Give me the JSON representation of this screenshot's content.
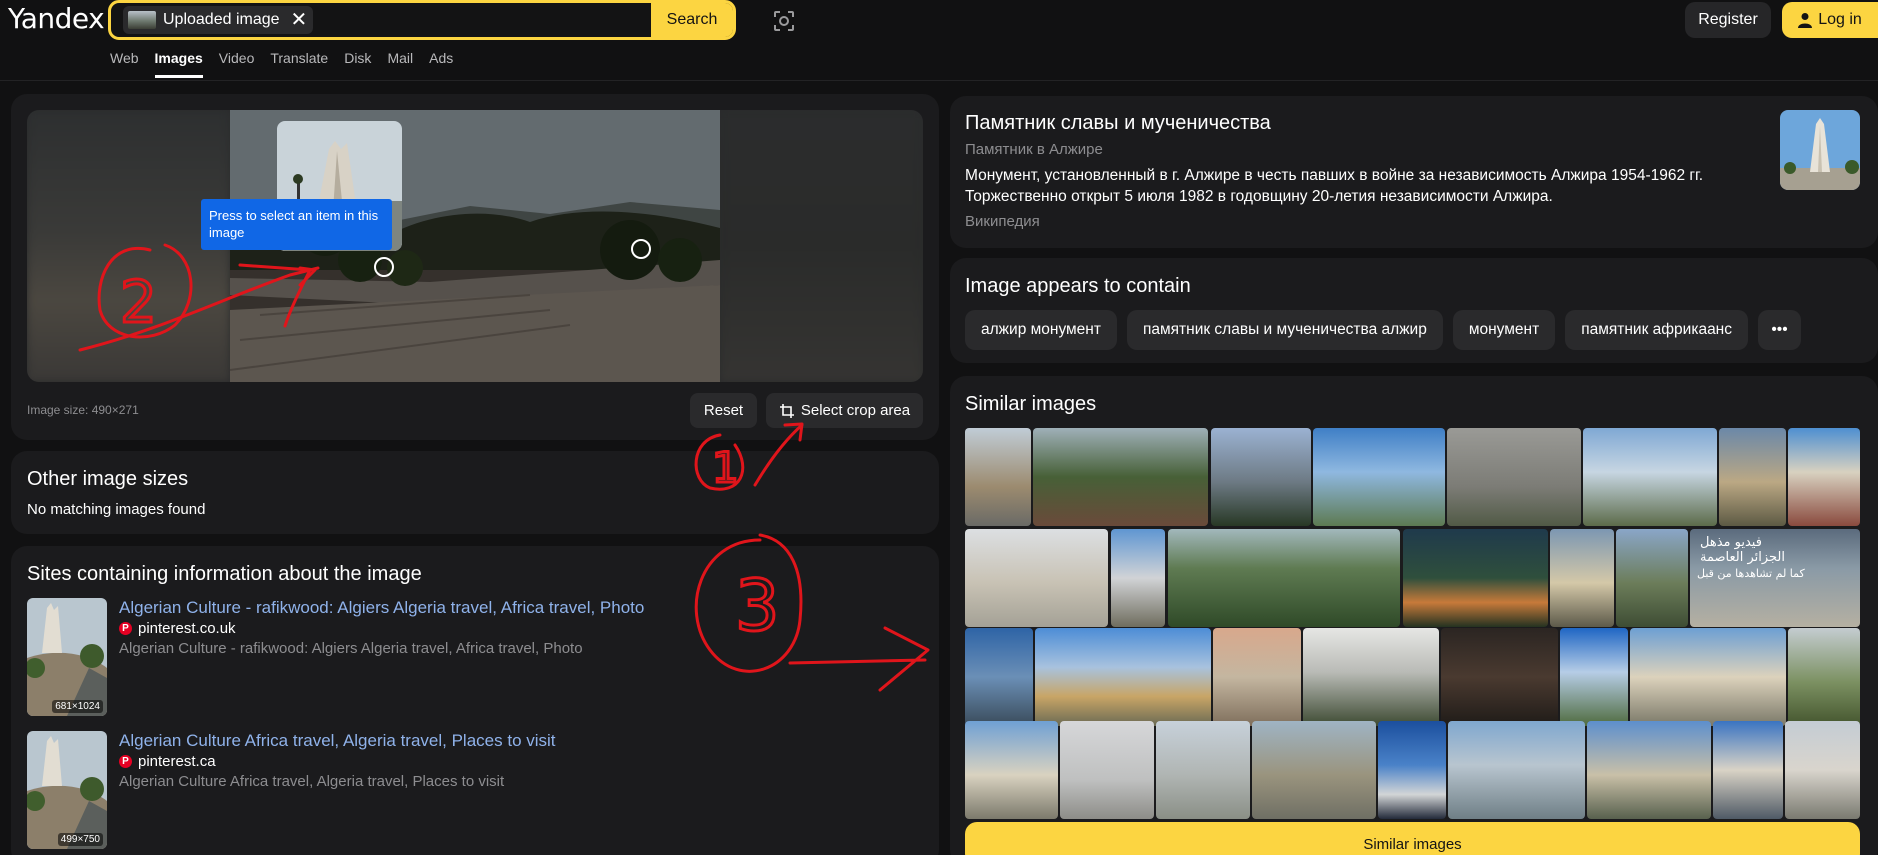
{
  "header": {
    "logo": "Yandex",
    "search_chip_label": "Uploaded image",
    "search_chip_close": "✕",
    "search_button": "Search",
    "register": "Register",
    "login": "Log in",
    "nav": [
      "Web",
      "Images",
      "Video",
      "Translate",
      "Disk",
      "Mail",
      "Ads"
    ],
    "active_nav": "Images"
  },
  "preview": {
    "tooltip": "Press to select an item in this image",
    "image_size": "Image size: 490×271",
    "reset": "Reset",
    "select_crop": "Select crop area"
  },
  "other_sizes": {
    "title": "Other image sizes",
    "text": "No matching images found"
  },
  "sites": {
    "title": "Sites containing information about the image",
    "items": [
      {
        "title": "Algerian Culture - rafikwood: Algiers Algeria travel, Africa travel, Photo",
        "domain": "pinterest.co.uk",
        "desc": "Algerian Culture - rafikwood: Algiers Algeria travel, Africa travel, Photo",
        "dims": "681×1024"
      },
      {
        "title": "Algerian Culture Africa travel, Algeria travel, Places to visit",
        "domain": "pinterest.ca",
        "desc": "Algerian Culture Africa travel, Algeria travel, Places to visit",
        "dims": "499×750"
      }
    ]
  },
  "knowledge": {
    "title": "Памятник славы и мученичества",
    "subtitle": "Памятник в Алжире",
    "description": "Монумент, установленный в г. Алжире в честь павших в войне за независимость Алжира 1954-1962 гг. Торжественно открыт 5 июля 1982 в годовщину 20-летия независимости Алжира.",
    "source": "Википедия"
  },
  "contains": {
    "title": "Image appears to contain",
    "tags": [
      "алжир монумент",
      "памятник славы и мученичества алжир",
      "монумент",
      "памятник африкаанс"
    ],
    "more": "•••"
  },
  "similar": {
    "title": "Similar images",
    "button": "Similar images",
    "overlay_text": [
      "فيديو مذهل",
      "الجزائر العاصمة",
      "كما لم تشاهدها من قبل"
    ]
  },
  "annotations": {
    "label_1": "1",
    "label_2": "2",
    "label_3": "3"
  },
  "colors": {
    "accent": "#fcd541",
    "link": "#8fb2ea",
    "annotation": "#e0151b",
    "tooltip": "#1067e6"
  }
}
